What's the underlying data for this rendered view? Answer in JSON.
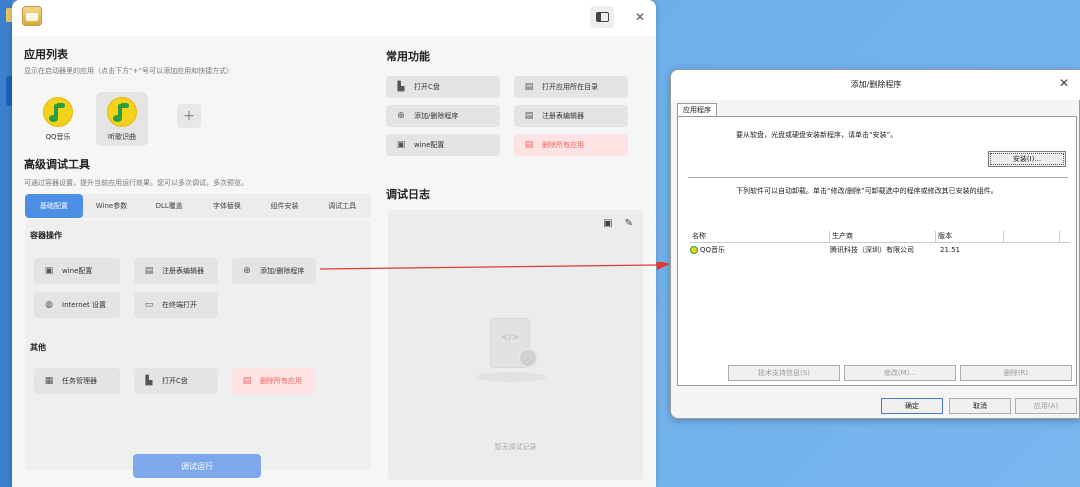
{
  "app": {
    "left": {
      "app_list_title": "应用列表",
      "app_list_subtitle": "显示在启动器里的应用（点击下方“+”号可以添加应用和快捷方式）",
      "apps": [
        {
          "name": "QQ音乐",
          "icon": "qq-music-icon"
        },
        {
          "name": "听歌识曲",
          "icon": "qq-music-icon"
        }
      ],
      "add_label": "+",
      "adv_title": "高级调试工具",
      "adv_subtitle": "可通过容器设置，提升当前应用运行效果。您可以多次调试，多次预览。",
      "tabs": [
        "基础配置",
        "Wine参数",
        "DLL覆盖",
        "字体替换",
        "组件安装",
        "调试工具"
      ],
      "container_ops_title": "容器操作",
      "container_ops": [
        {
          "label": "wine配置",
          "icon": "wine-config-icon"
        },
        {
          "label": "注册表编辑器",
          "icon": "registry-icon"
        },
        {
          "label": "添加/删除程序",
          "icon": "basket-icon"
        },
        {
          "label": "Internet 设置",
          "icon": "globe-icon"
        },
        {
          "label": "在终端打开",
          "icon": "terminal-icon"
        }
      ],
      "other_title": "其他",
      "other_ops": [
        {
          "label": "任务管理器",
          "icon": "briefcase-icon"
        },
        {
          "label": "打开C盘",
          "icon": "drive-icon"
        },
        {
          "label": "删除所有应用",
          "icon": "delete-apps-icon",
          "danger": true
        }
      ],
      "run_button": "调试运行"
    },
    "right": {
      "common_title": "常用功能",
      "common": [
        {
          "label": "打开C盘",
          "icon": "drive-icon"
        },
        {
          "label": "打开应用所在目录",
          "icon": "folder-icon"
        },
        {
          "label": "添加/删除程序",
          "icon": "basket-icon"
        },
        {
          "label": "注册表编辑器",
          "icon": "registry-icon"
        },
        {
          "label": "wine配置",
          "icon": "wine-config-icon"
        },
        {
          "label": "删除所有应用",
          "icon": "delete-apps-icon",
          "danger": true
        }
      ],
      "log_title": "调试日志",
      "log_empty": "暂无调试记录"
    },
    "titlebar": {
      "close": "✕"
    }
  },
  "dialog": {
    "title": "添加/删除程序",
    "tab": "应用程序",
    "install_hint": "要从软盘，光盘或硬盘安装新程序，请单击“安装”。",
    "install_button": "安装(I)...",
    "uninstall_hint": "下列软件可以自动卸载。单击“修改/删除”可卸载选中的程序或修改其已安装的组件。",
    "columns": [
      "名称",
      "生产商",
      "版本"
    ],
    "rows": [
      {
        "name": "QQ音乐",
        "vendor": "腾讯科技（深圳）有限公司",
        "version": "21.51"
      }
    ],
    "support_button": "技术支持信息(S)",
    "modify_button": "修改(M)...",
    "remove_button": "删除(R)",
    "ok_button": "确定",
    "cancel_button": "取消",
    "apply_button": "应用(A)"
  },
  "colors": {
    "accent": "#4e8fe6",
    "danger": "#e66666",
    "arrow": "#e53935"
  }
}
